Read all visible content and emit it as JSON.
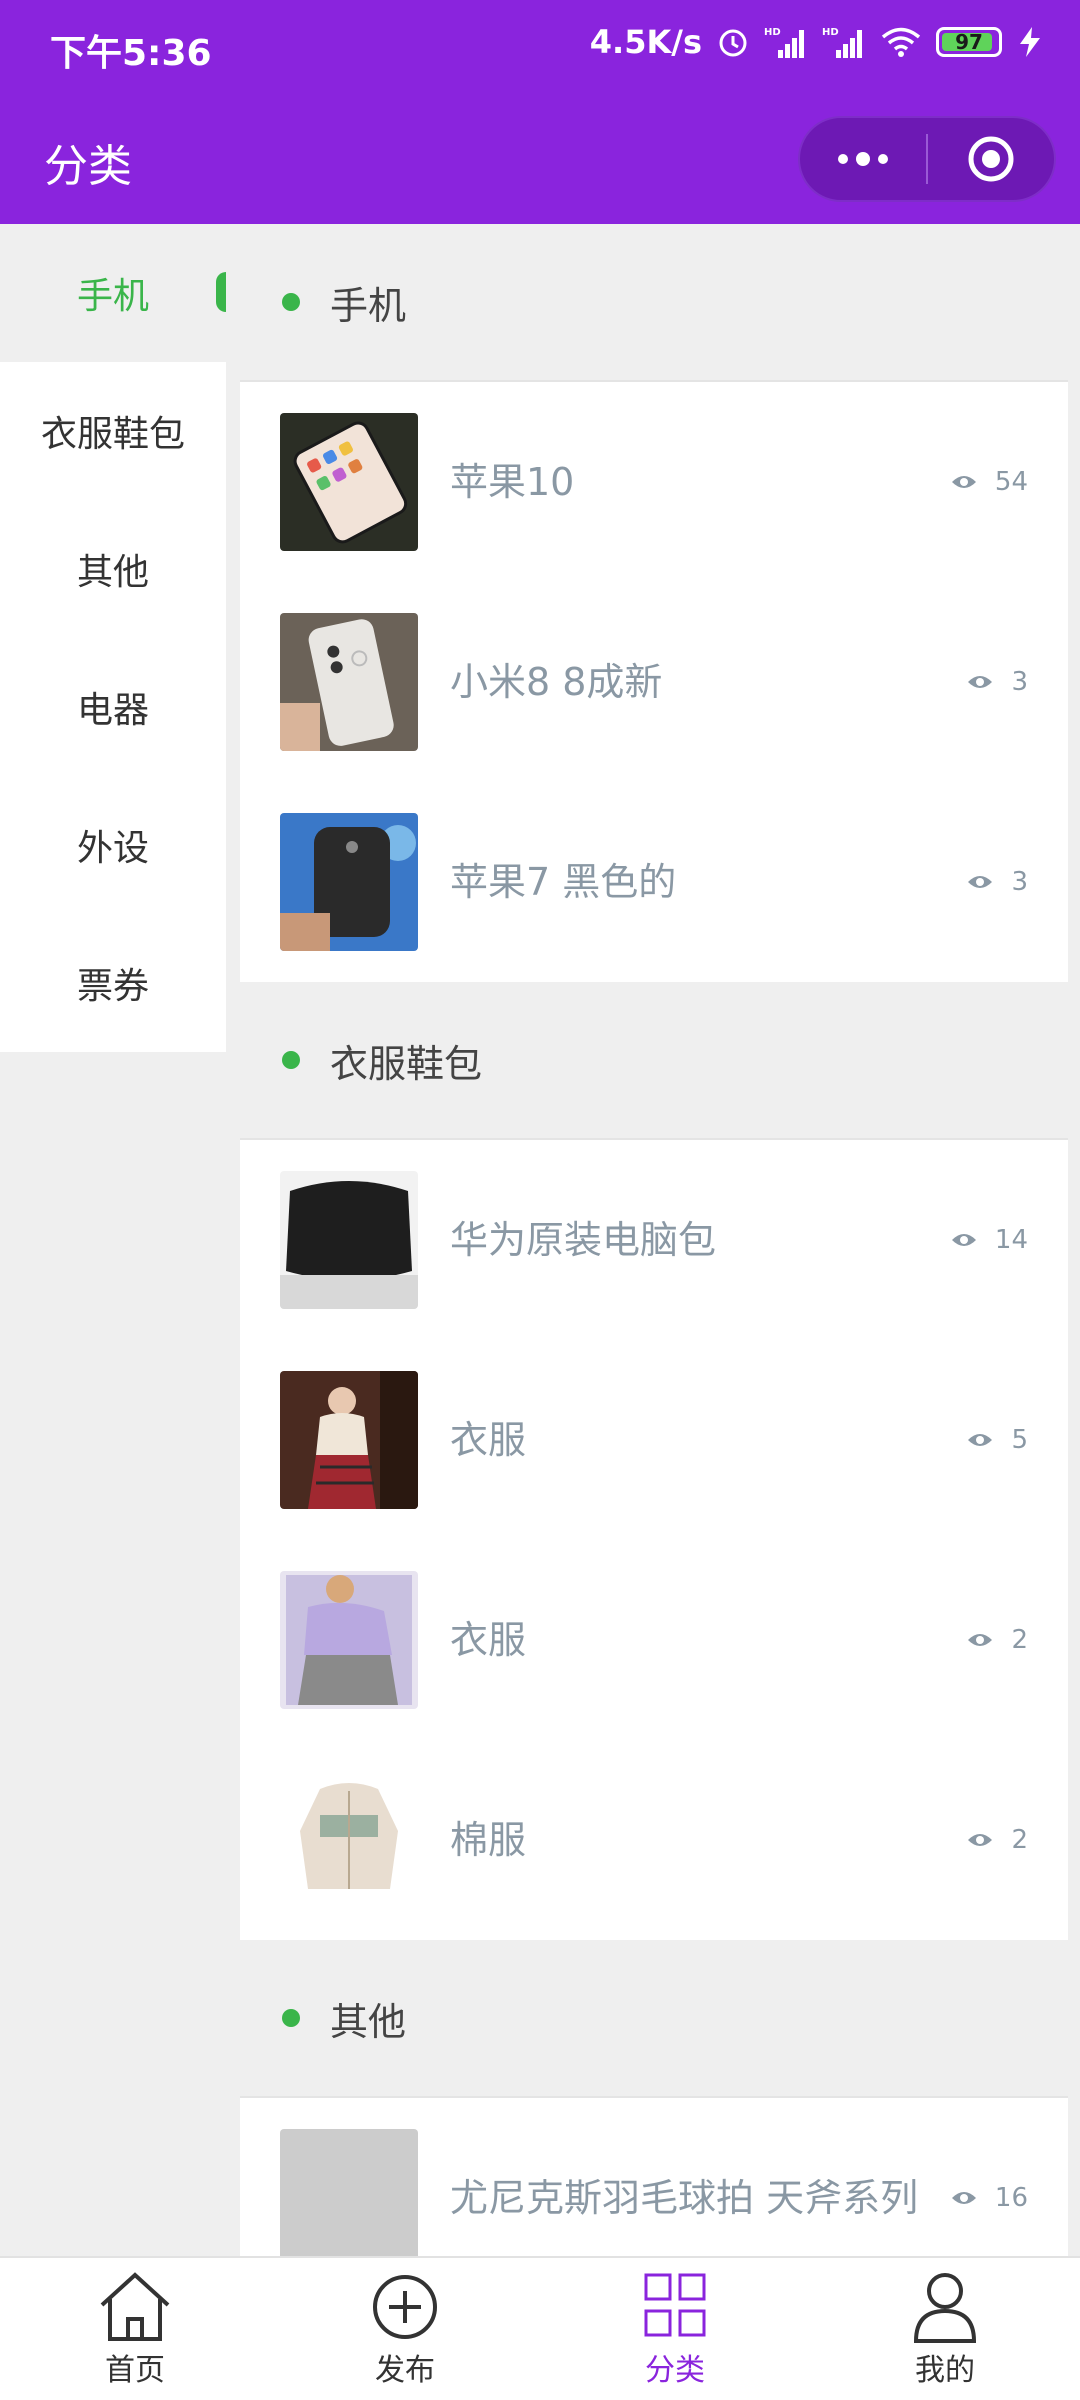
{
  "status_bar": {
    "time": "下午5:36",
    "net_speed": "4.5K/s",
    "battery_level": "97"
  },
  "title_bar": {
    "title": "分类"
  },
  "sidebar": {
    "items": [
      {
        "label": "手机",
        "active": true
      },
      {
        "label": "衣服鞋包",
        "active": false
      },
      {
        "label": "其他",
        "active": false
      },
      {
        "label": "电器",
        "active": false
      },
      {
        "label": "外设",
        "active": false
      },
      {
        "label": "票券",
        "active": false
      }
    ]
  },
  "sections": [
    {
      "title": "手机",
      "items": [
        {
          "title": "苹果10",
          "views": "54"
        },
        {
          "title": "小米8 8成新",
          "views": "3"
        },
        {
          "title": "苹果7 黑色的",
          "views": "3"
        }
      ]
    },
    {
      "title": "衣服鞋包",
      "items": [
        {
          "title": "华为原装电脑包",
          "views": "14"
        },
        {
          "title": "衣服",
          "views": "5"
        },
        {
          "title": "衣服",
          "views": "2"
        },
        {
          "title": "棉服",
          "views": "2"
        }
      ]
    },
    {
      "title": "其他",
      "items": [
        {
          "title": "尤尼克斯羽毛球拍 天斧系列",
          "views": "16"
        }
      ]
    }
  ],
  "tabbar": {
    "items": [
      {
        "label": "首页",
        "icon": "home-icon",
        "active": false
      },
      {
        "label": "发布",
        "icon": "plus-circle-icon",
        "active": false
      },
      {
        "label": "分类",
        "icon": "grid-icon",
        "active": true
      },
      {
        "label": "我的",
        "icon": "user-icon",
        "active": false
      }
    ]
  },
  "colors": {
    "brand": "#8a24dd",
    "accent_green": "#3ab54a",
    "muted_text": "#8a98a4"
  }
}
